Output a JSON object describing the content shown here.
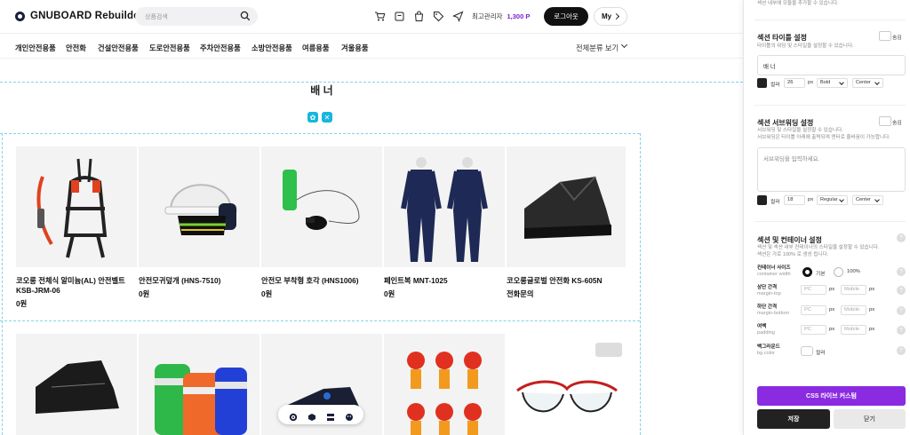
{
  "header": {
    "logo": "GNUBOARD Rebuilder",
    "search_placeholder": "상품검색",
    "admin_label": "최고관리자",
    "points": "1,300 P",
    "logout": "로그아웃",
    "my": "My"
  },
  "nav": {
    "items": [
      "개인안전용품",
      "안전화",
      "건설안전용품",
      "도로안전용품",
      "주차안전용품",
      "소방안전용품",
      "여름용품",
      "겨울용품"
    ],
    "all_categories": "전체분류 보기"
  },
  "section": {
    "title": "배 너"
  },
  "products": [
    {
      "name": "코오롱 전체식 알미늄(AL) 안전벨트 KSB-JRM-06",
      "price": "0원"
    },
    {
      "name": "안전모귀덮개 (HNS-7510)",
      "price": "0원"
    },
    {
      "name": "안전모 부착형 호각 (HNS1006)",
      "price": "0원"
    },
    {
      "name": "페인트복 MNT-1025",
      "price": "0원"
    },
    {
      "name": "코오롱글로벌 안전화 KS-605N",
      "price": "전화문의"
    }
  ],
  "panel": {
    "top_hint": "섹션 내부에 모듈을 추가할 수 있습니다.",
    "title_section": {
      "title": "섹션 타이틀 설정",
      "hint": "타이틀의 워딩 및 스타일을 설정할 수 있습니다.",
      "hide": "숨김",
      "value": "배 너",
      "color_label": "컬러",
      "size": "26",
      "unit": "px",
      "weight": "Bold",
      "align": "Center"
    },
    "subtitle_section": {
      "title": "섹션 서브워딩 설정",
      "hint1": "서브워딩 및 스타일을 설정할 수 있습니다.",
      "hint2": "서브워딩은 타이틀 아래에 출력되며 엔터로 줄바꿈이 가능합니다.",
      "hide": "숨김",
      "placeholder": "서브워딩을 입력하세요.",
      "color_label": "컬러",
      "size": "18",
      "unit": "px",
      "weight": "Regular",
      "align": "Center"
    },
    "container_section": {
      "title": "섹션 및 컨테이너 설정",
      "hint1": "섹션 및 섹션 내부 컨테이너의 스타일을 설정할 수 있습니다.",
      "hint2": "섹션은 가로 100% 로 생성 됩니다.",
      "width_label": "컨테이너 사이즈",
      "width_sub": "container width",
      "opt_basic": "기본",
      "opt_full": "100%",
      "margin_top": "상단 간격",
      "margin_top_sub": "margin-top",
      "margin_bottom": "하단 간격",
      "margin_bottom_sub": "margin-bottom",
      "padding": "여백",
      "padding_sub": "padding",
      "pc": "PC",
      "mobile": "Mobile",
      "unit": "px",
      "bg_label": "백그라운드",
      "bg_sub": "bg color",
      "bg_color": "컬러"
    },
    "css_button": "CSS 라이브 커스텀",
    "save": "저장",
    "close": "닫기"
  },
  "colors": {
    "accent_purple": "#8a2be2",
    "points_purple": "#7b1fd8",
    "cyan_control": "#17b6dd",
    "dark": "#111111"
  }
}
